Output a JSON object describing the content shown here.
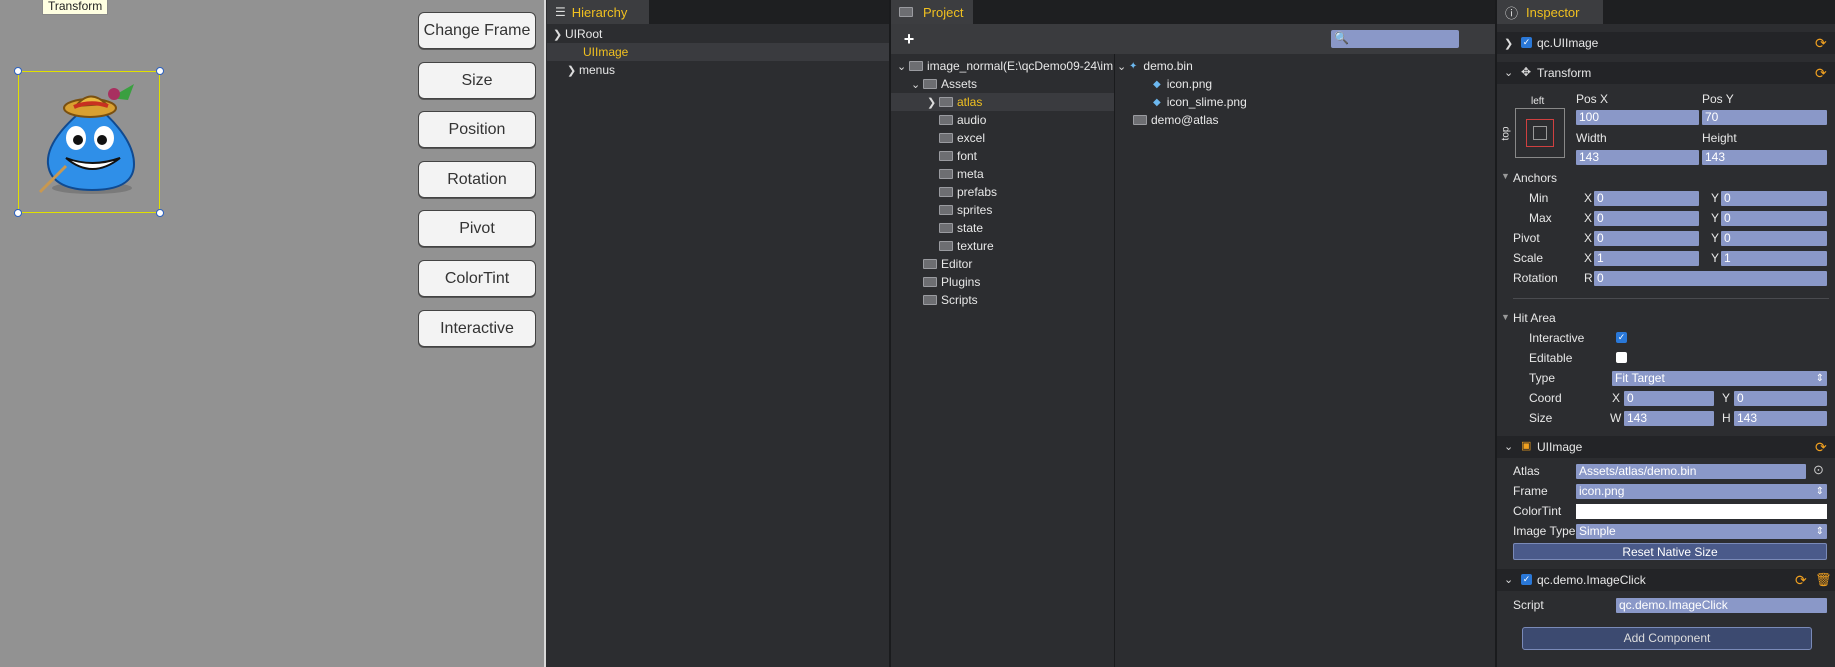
{
  "scene": {
    "tooltip": "Transform",
    "buttons": [
      "Change Frame",
      "Size",
      "Position",
      "Rotation",
      "Pivot",
      "ColorTint",
      "Interactive"
    ]
  },
  "hierarchy": {
    "tab": "Hierarchy",
    "items": [
      "UIRoot",
      "UIImage",
      "menus"
    ]
  },
  "project": {
    "tab": "Project",
    "add_label": "+",
    "tree": [
      "image_normal(E:\\qcDemo09-24\\im",
      "Assets",
      "atlas",
      "audio",
      "excel",
      "font",
      "meta",
      "prefabs",
      "sprites",
      "state",
      "texture",
      "Editor",
      "Plugins",
      "Scripts"
    ],
    "files": [
      "demo.bin",
      "icon.png",
      "icon_slime.png",
      "demo@atlas"
    ]
  },
  "inspector": {
    "tab": "Inspector",
    "object_name": "qc.UIImage",
    "transform": {
      "title": "Transform",
      "left": "left",
      "top": "top",
      "posx_label": "Pos X",
      "posy_label": "Pos Y",
      "posx": "100",
      "posy": "70",
      "width_label": "Width",
      "height_label": "Height",
      "width": "143",
      "height": "143",
      "anchors": "Anchors",
      "min": "Min",
      "max": "Max",
      "pivot": "Pivot",
      "scale": "Scale",
      "rotation": "Rotation",
      "x": "X",
      "y": "Y",
      "r": "R",
      "min_x": "0",
      "min_y": "0",
      "max_x": "0",
      "max_y": "0",
      "pivot_x": "0",
      "pivot_y": "0",
      "scale_x": "1",
      "scale_y": "1",
      "rot": "0"
    },
    "hit_area": {
      "title": "Hit Area",
      "interactive": "Interactive",
      "editable": "Editable",
      "type": "Type",
      "coord": "Coord",
      "size": "Size",
      "type_value": "Fit Target",
      "coord_x_label": "X",
      "coord_y_label": "Y",
      "coord_x": "0",
      "coord_y": "0",
      "w_label": "W",
      "h_label": "H",
      "w": "143",
      "h": "143"
    },
    "uiimage": {
      "title": "UIImage",
      "atlas_label": "Atlas",
      "atlas": "Assets/atlas/demo.bin",
      "frame_label": "Frame",
      "frame": "icon.png",
      "colortint_label": "ColorTint",
      "imagetype_label": "Image Type",
      "imagetype": "Simple",
      "reset": "Reset Native Size"
    },
    "script_comp": {
      "title": "qc.demo.ImageClick",
      "script_label": "Script",
      "script": "qc.demo.ImageClick"
    },
    "add_component": "Add Component"
  },
  "colors": {
    "accent": "#f0c020",
    "field": "#8a98c8",
    "panel": "#2c2d30"
  }
}
